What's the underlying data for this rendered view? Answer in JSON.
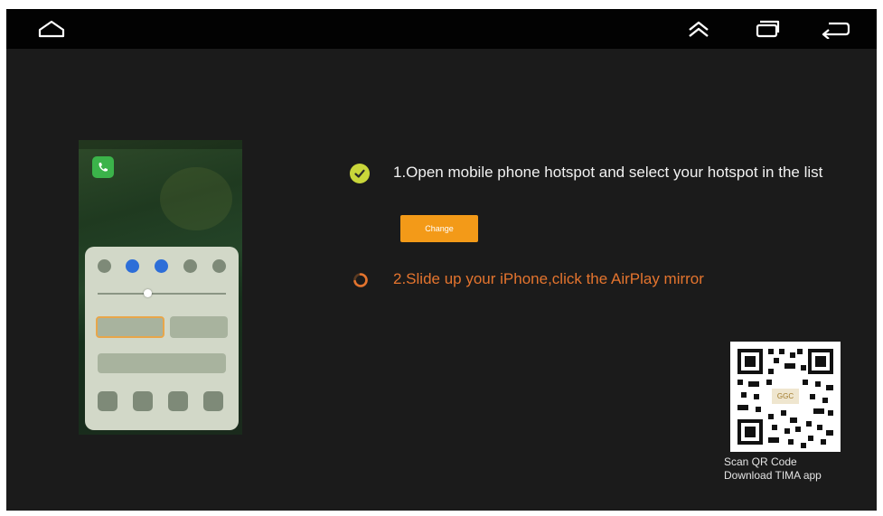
{
  "navbar": {
    "icons": [
      "home-icon",
      "up-chevrons-icon",
      "recent-apps-icon",
      "back-icon"
    ]
  },
  "phone_preview": {
    "controls": [
      "airplane-mode-icon",
      "wifi-icon",
      "bluetooth-icon",
      "do-not-disturb-icon",
      "orientation-lock-icon"
    ],
    "shortcuts": [
      "flashlight-icon",
      "timer-icon",
      "calculator-icon",
      "camera-icon"
    ]
  },
  "steps": {
    "step1": {
      "text": "1.Open mobile phone hotspot and select your hotspot in the list",
      "status": "done",
      "status_color": "#c9d63a"
    },
    "change_button": {
      "label": "Change",
      "color": "#f39a18"
    },
    "step2": {
      "text": "2.Slide up your iPhone,click the AirPlay mirror",
      "status": "in-progress",
      "color": "#e4742e"
    }
  },
  "qr": {
    "caption_line1": "Scan QR Code",
    "caption_line2": "Download TIMA app"
  }
}
